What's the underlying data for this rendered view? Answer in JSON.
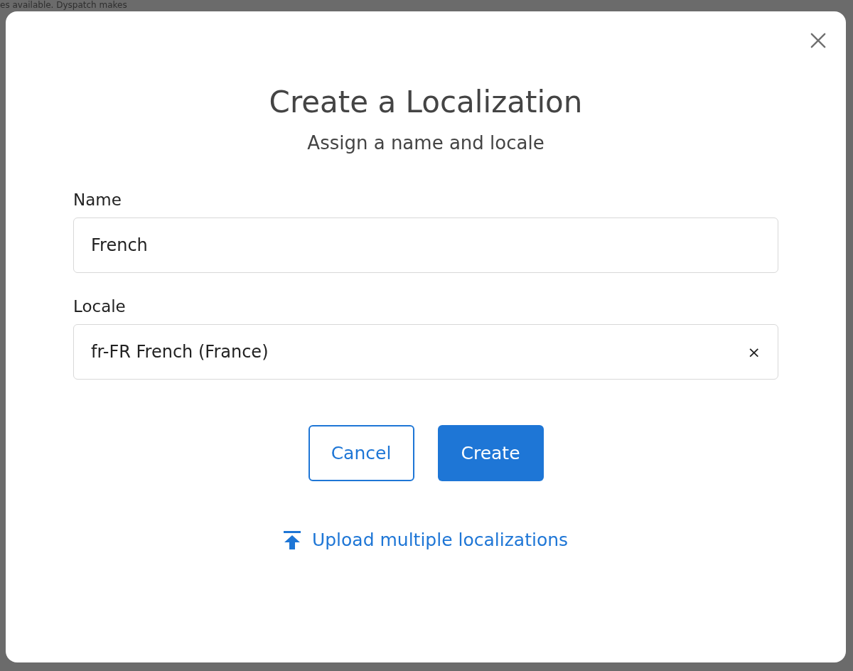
{
  "background": {
    "text": "es available. Dyspatch makes"
  },
  "dialog": {
    "title": "Create a Localization",
    "subtitle": "Assign a name and locale",
    "fields": [
      {
        "kind": "text",
        "label": "Name",
        "value": "French"
      },
      {
        "kind": "select",
        "label": "Locale",
        "value": "fr-FR French (France)",
        "clear": "×"
      }
    ],
    "buttons": [
      {
        "kind": "secondary",
        "label": "Cancel"
      },
      {
        "kind": "primary",
        "label": "Create"
      }
    ],
    "link": {
      "label": "Upload multiple localizations"
    }
  }
}
